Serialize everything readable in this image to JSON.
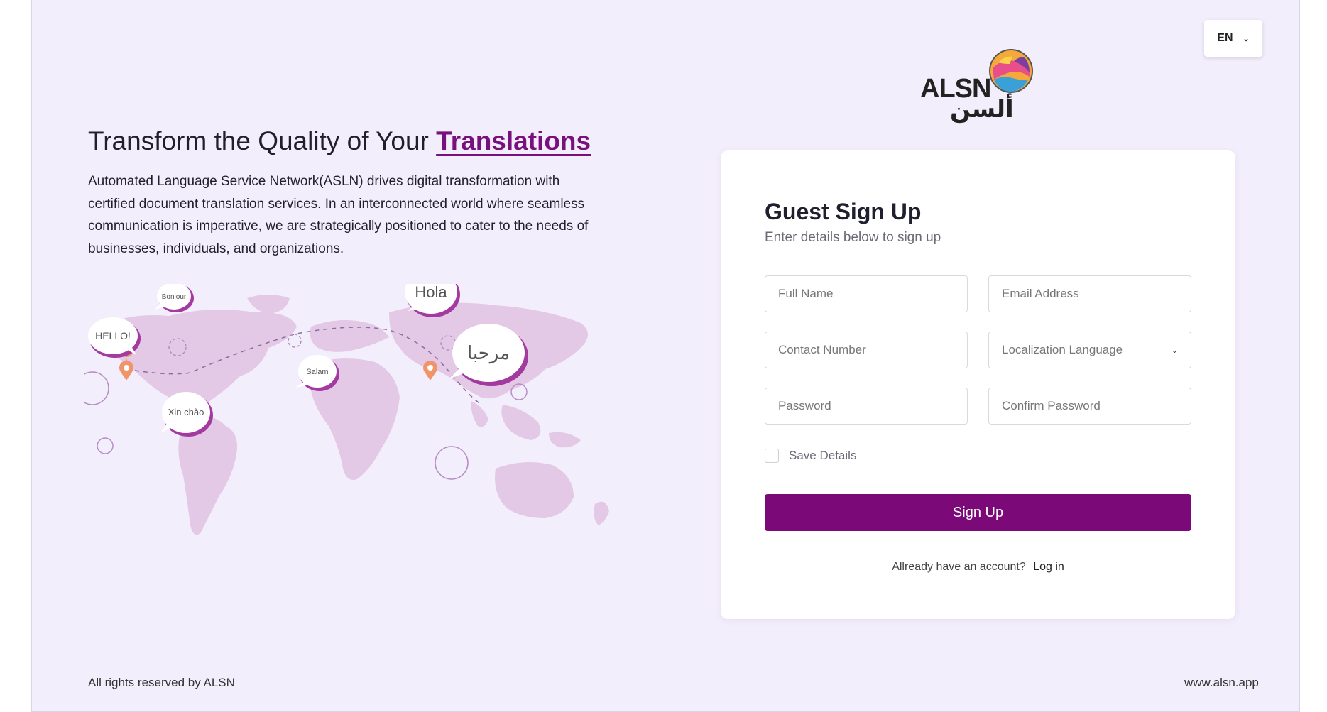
{
  "header": {
    "language": "EN",
    "logo": {
      "text": "ALSN",
      "arabic_text": "ألسن"
    }
  },
  "hero": {
    "headline_prefix": "Transform the Quality of Your ",
    "headline_highlight": "Translations",
    "description": "Automated Language Service Network(ASLN) drives digital transformation with certified document translation services. In an interconnected world where seamless communication is imperative, we are strategically positioned to cater to the needs of businesses, individuals, and organizations.",
    "map_bubbles": [
      "Bonjour",
      "Hola",
      "HELLO!",
      "مرحبا",
      "Salam",
      "Xin chào"
    ]
  },
  "form": {
    "title": "Guest Sign Up",
    "subtitle": "Enter details below to sign up",
    "fields": {
      "full_name": {
        "placeholder": "Full Name"
      },
      "email": {
        "placeholder": "Email Address"
      },
      "contact": {
        "placeholder": "Contact Number"
      },
      "localization": {
        "placeholder": "Localization Language"
      },
      "password": {
        "placeholder": "Password"
      },
      "confirm_password": {
        "placeholder": "Confirm Password"
      }
    },
    "save_details_label": "Save Details",
    "submit_label": "Sign Up",
    "login_prompt": "Allready have an account?",
    "login_link": "Log in"
  },
  "footer": {
    "copyright": "All rights reserved by ALSN",
    "website": "www.alsn.app"
  },
  "colors": {
    "accent": "#7b0a78",
    "background": "#f3eefc",
    "map": "#e3c9e6",
    "pin": "#f0956a"
  }
}
